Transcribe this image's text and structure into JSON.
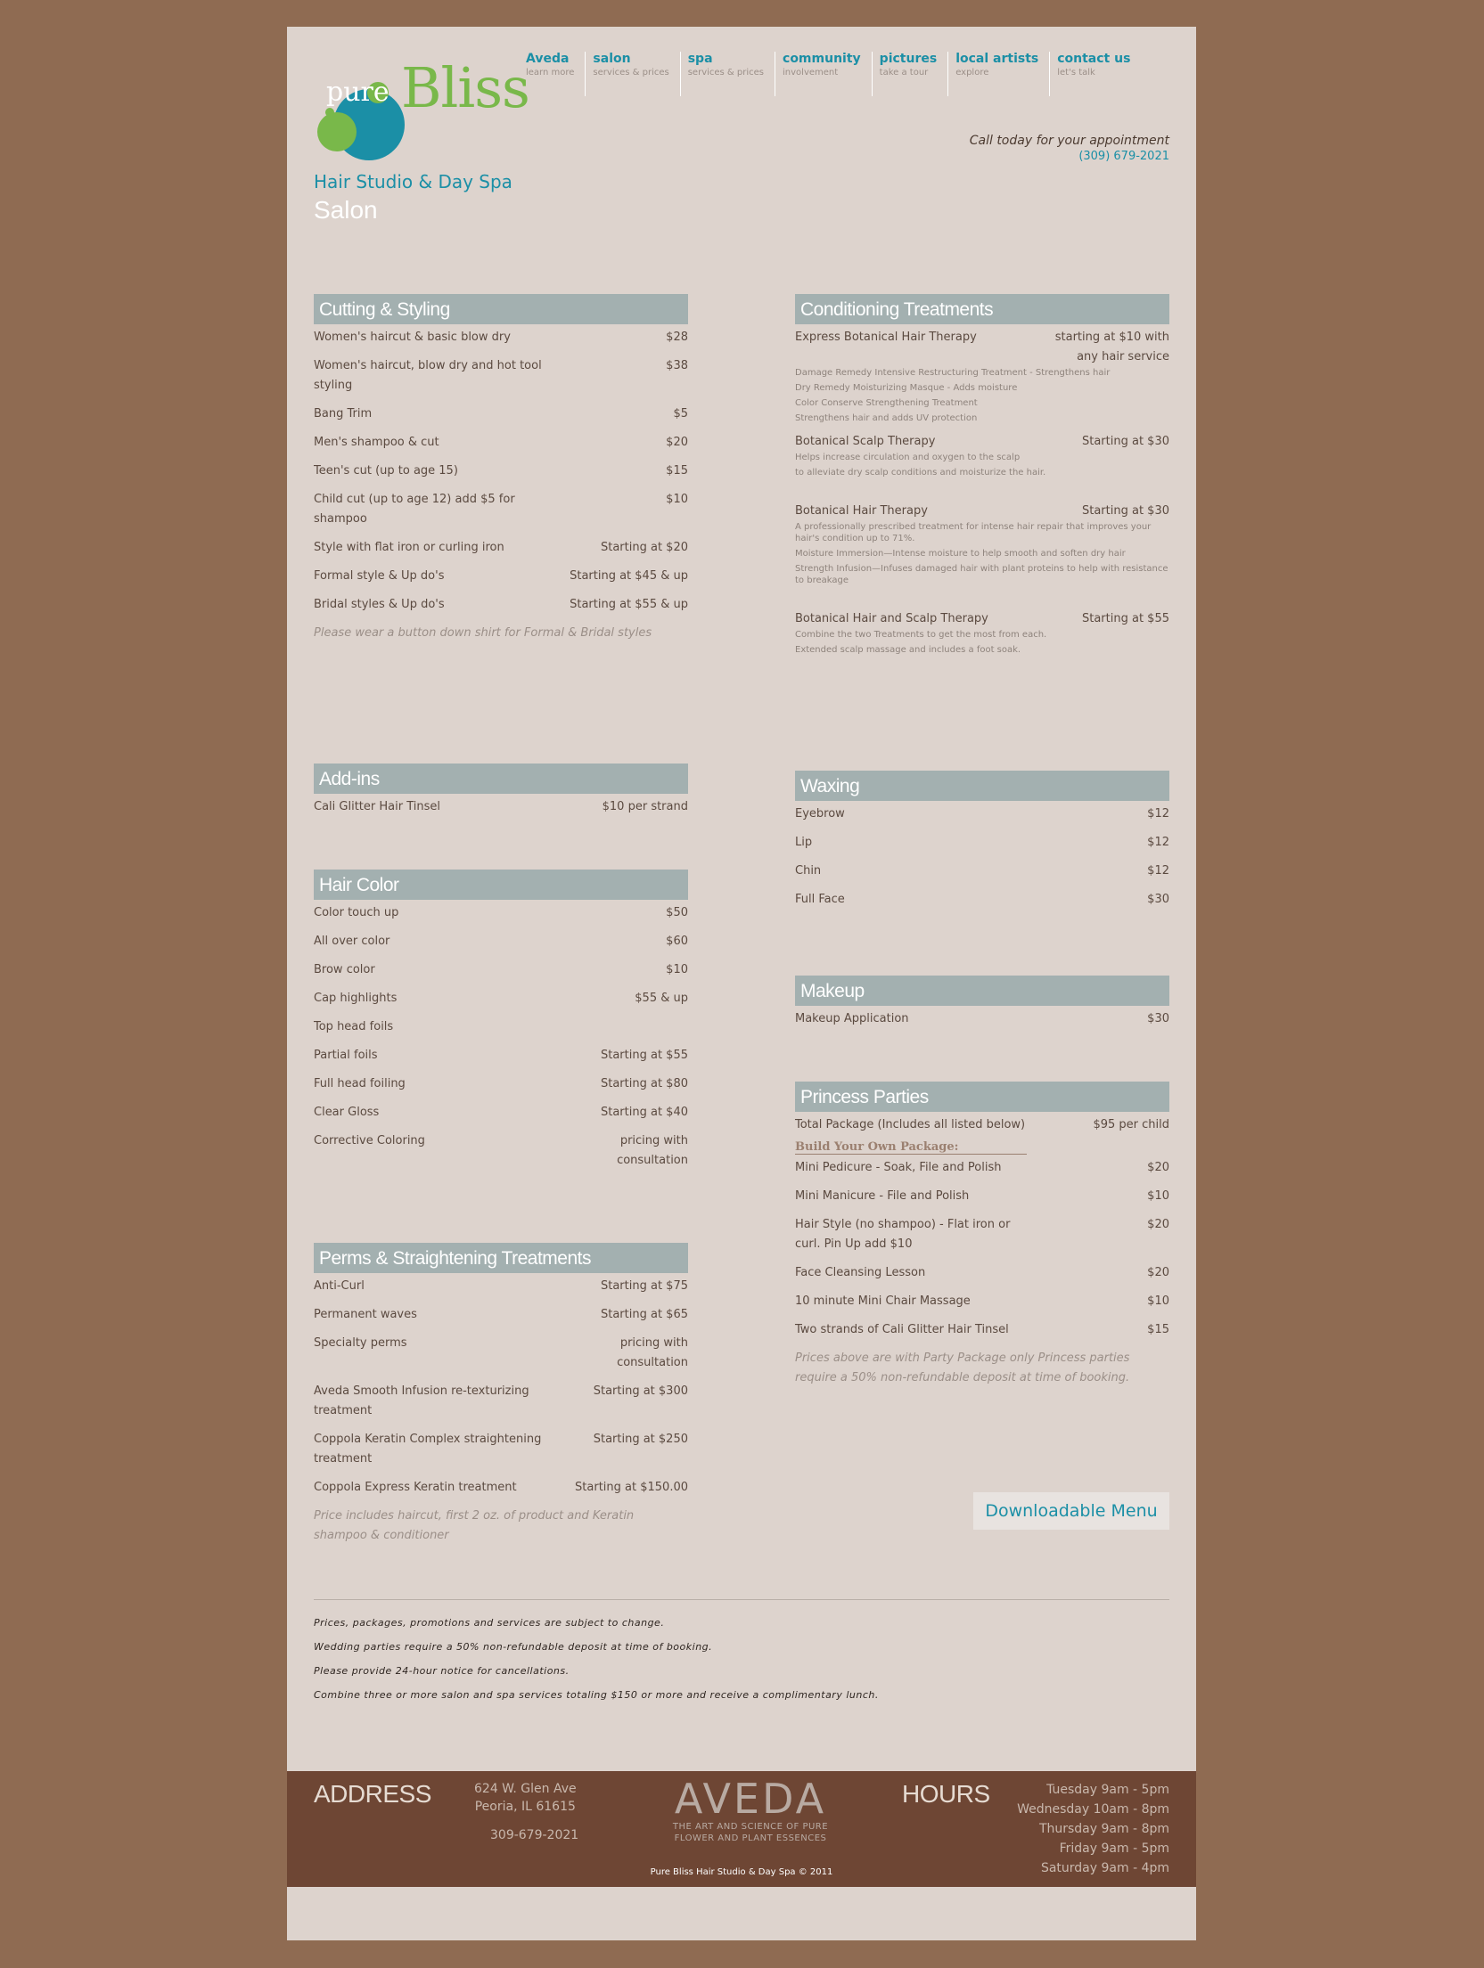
{
  "brand": {
    "pure": "pure",
    "bliss": "Bliss",
    "tagline": "Hair Studio & Day Spa"
  },
  "nav": [
    {
      "title": "Aveda",
      "sub": "learn more"
    },
    {
      "title": "salon",
      "sub": "services & prices"
    },
    {
      "title": "spa",
      "sub": "services & prices"
    },
    {
      "title": "community",
      "sub": "involvement"
    },
    {
      "title": "pictures",
      "sub": "take a tour"
    },
    {
      "title": "local artists",
      "sub": "explore"
    },
    {
      "title": "contact us",
      "sub": "let's talk"
    }
  ],
  "call": {
    "text": "Call today for your appointment",
    "phone": "(309) 679-2021"
  },
  "page_title": "Salon",
  "cutting": {
    "title": "Cutting & Styling",
    "items": [
      {
        "name": "Women's haircut & basic blow dry",
        "price": "$28"
      },
      {
        "name": "Women's haircut, blow dry and hot tool styling",
        "price": "$38"
      },
      {
        "name": "Bang Trim",
        "price": "$5"
      },
      {
        "name": "Men's shampoo & cut",
        "price": "$20"
      },
      {
        "name": "Teen's cut (up to age 15)",
        "price": "$15"
      },
      {
        "name": "Child cut (up to age 12) add $5 for shampoo",
        "price": "$10"
      },
      {
        "name": "Style with flat iron or curling iron",
        "price": "Starting at $20"
      },
      {
        "name": "Formal style & Up do's",
        "price": "Starting at $45 & up"
      },
      {
        "name": "Bridal styles & Up do's",
        "price": "Starting at $55 & up"
      }
    ],
    "note": "Please wear a button down shirt for Formal & Bridal styles"
  },
  "conditioning": {
    "title": "Conditioning Treatments",
    "t1": {
      "name": "Express Botanical Hair Therapy",
      "price": "starting at $10 with any hair service",
      "d1": "Damage Remedy Intensive Restructuring Treatment - Strengthens hair",
      "d2": "Dry Remedy Moisturizing Masque - Adds moisture",
      "d3": "Color Conserve Strengthening Treatment",
      "d4": "Strengthens hair and adds UV protection"
    },
    "t2": {
      "name": "Botanical Scalp Therapy",
      "price": "Starting at $30",
      "d1": "Helps increase circulation and oxygen to the scalp",
      "d2": "to alleviate dry scalp conditions and moisturize the hair."
    },
    "t3": {
      "name": "Botanical Hair Therapy",
      "price": "Starting at $30",
      "d1": "A professionally prescribed treatment for intense hair repair that improves your hair's condition up to 71%.",
      "d2": "Moisture Immersion—Intense moisture to help smooth and soften dry hair",
      "d3": "Strength Infusion—Infuses damaged hair with plant proteins to help with resistance to breakage"
    },
    "t4": {
      "name": "Botanical Hair and Scalp Therapy",
      "price": "Starting at $55",
      "d1": "Combine the two Treatments to get the most from each.",
      "d2": "Extended scalp massage and includes a foot soak."
    }
  },
  "addins": {
    "title": "Add-ins",
    "items": [
      {
        "name": "Cali Glitter Hair Tinsel",
        "price": "$10 per strand"
      }
    ]
  },
  "waxing": {
    "title": "Waxing",
    "items": [
      {
        "name": "Eyebrow",
        "price": "$12"
      },
      {
        "name": "Lip",
        "price": "$12"
      },
      {
        "name": "Chin",
        "price": "$12"
      },
      {
        "name": "Full Face",
        "price": "$30"
      }
    ]
  },
  "haircolor": {
    "title": "Hair Color",
    "items": [
      {
        "name": "Color touch up",
        "price": "$50"
      },
      {
        "name": "All over color",
        "price": "$60"
      },
      {
        "name": "Brow color",
        "price": "$10"
      },
      {
        "name": "Cap highlights",
        "price": "$55 & up"
      },
      {
        "name": "Top head foils",
        "price": ""
      },
      {
        "name": "Partial foils",
        "price": "Starting at $55"
      },
      {
        "name": "Full head foiling",
        "price": "Starting at $80"
      },
      {
        "name": "Clear Gloss",
        "price": "Starting at $40"
      },
      {
        "name": "Corrective Coloring",
        "price": "pricing with consultation"
      }
    ]
  },
  "makeup": {
    "title": "Makeup",
    "items": [
      {
        "name": "Makeup Application",
        "price": "$30"
      }
    ]
  },
  "princess": {
    "title": "Princess Parties",
    "total": {
      "name": "Total Package (Includes all listed below)",
      "price": "$95 per child"
    },
    "build": "Build Your Own Package:",
    "items": [
      {
        "name": "Mini Pedicure - Soak, File and Polish",
        "price": "$20"
      },
      {
        "name": "Mini Manicure - File and Polish",
        "price": "$10"
      },
      {
        "name": "Hair Style (no shampoo) - Flat iron or curl. Pin Up add $10",
        "price": "$20"
      },
      {
        "name": "Face Cleansing Lesson",
        "price": "$20"
      },
      {
        "name": "10 minute Mini Chair Massage",
        "price": "$10"
      },
      {
        "name": "Two strands of Cali Glitter Hair Tinsel",
        "price": "$15"
      }
    ],
    "note": "Prices above are with Party Package only Princess parties require a 50% non-refundable deposit at time of booking."
  },
  "perms": {
    "title": "Perms & Straightening Treatments",
    "items": [
      {
        "name": "Anti-Curl",
        "price": "Starting at $75"
      },
      {
        "name": "Permanent waves",
        "price": "Starting at $65"
      },
      {
        "name": "Specialty perms",
        "price": "pricing with consultation"
      },
      {
        "name": "Aveda Smooth Infusion re-texturizing treatment",
        "price": "Starting at $300"
      },
      {
        "name": "Coppola Keratin Complex straightening treatment",
        "price": "Starting at $250"
      },
      {
        "name": "Coppola Express Keratin treatment",
        "price": "Starting at $150.00"
      }
    ],
    "note": "Price includes haircut, first 2 oz. of product and Keratin shampoo & conditioner"
  },
  "download_label": "Downloadable Menu",
  "policies": [
    "Prices, packages, promotions and services are subject to change.",
    "Wedding parties require a 50% non-refundable deposit at time of booking.",
    "Please provide 24-hour notice for cancellations.",
    "Combine three or more salon and spa services totaling $150 or more and receive a complimentary lunch."
  ],
  "footer": {
    "address_label": "ADDRESS",
    "address1": "624 W. Glen Ave",
    "address2": "Peoria, IL 61615",
    "phone": "309-679-2021",
    "aveda": "AVEDA",
    "aveda_tag1": "THE ART AND SCIENCE OF PURE",
    "aveda_tag2": "FLOWER AND PLANT ESSENCES",
    "hours_label": "HOURS",
    "hours": [
      "Tuesday 9am - 5pm",
      "Wednesday 10am - 8pm",
      "Thursday 9am - 8pm",
      "Friday 9am - 5pm",
      "Saturday 9am - 4pm"
    ],
    "copyright": "Pure Bliss Hair Studio & Day Spa © 2011"
  },
  "colors": {
    "background": "#8f6b52",
    "page": "#ddd3cd",
    "accent": "#1b8fa6",
    "section_header": "#a3b0b0",
    "footer": "#6e4634",
    "logo_green": "#79b84a"
  }
}
